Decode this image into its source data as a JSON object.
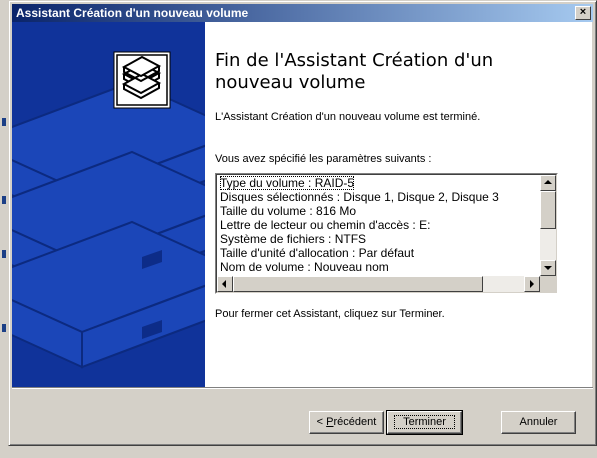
{
  "window": {
    "title": "Assistant Création d'un nouveau volume",
    "close_label": "×"
  },
  "banner": {
    "icon": "stacked-disks-icon"
  },
  "content": {
    "heading_line1": "Fin de l'Assistant Création d'un",
    "heading_line2": "nouveau volume",
    "completed_text": "L'Assistant Création d'un nouveau volume est terminé.",
    "params_intro": "Vous avez spécifié les paramètres suivants :",
    "settings": [
      "Type du volume : RAID-5",
      "Disques sélectionnés : Disque 1, Disque 2, Disque 3",
      "Taille du volume : 816 Mo",
      "Lettre de lecteur ou chemin d'accès : E:",
      "Système de fichiers : NTFS",
      "Taille d'unité d'allocation : Par défaut",
      "Nom de volume : Nouveau nom"
    ],
    "close_hint": "Pour fermer cet Assistant, cliquez sur Terminer."
  },
  "buttons": {
    "back_prefix": "< ",
    "back_accel": "P",
    "back_rest": "récédent",
    "finish": "Terminer",
    "cancel": "Annuler"
  },
  "colors": {
    "title_start": "#0a246a",
    "title_end": "#a6caf0",
    "banner_blue": "#10339a",
    "face": "#d4d0c8"
  }
}
